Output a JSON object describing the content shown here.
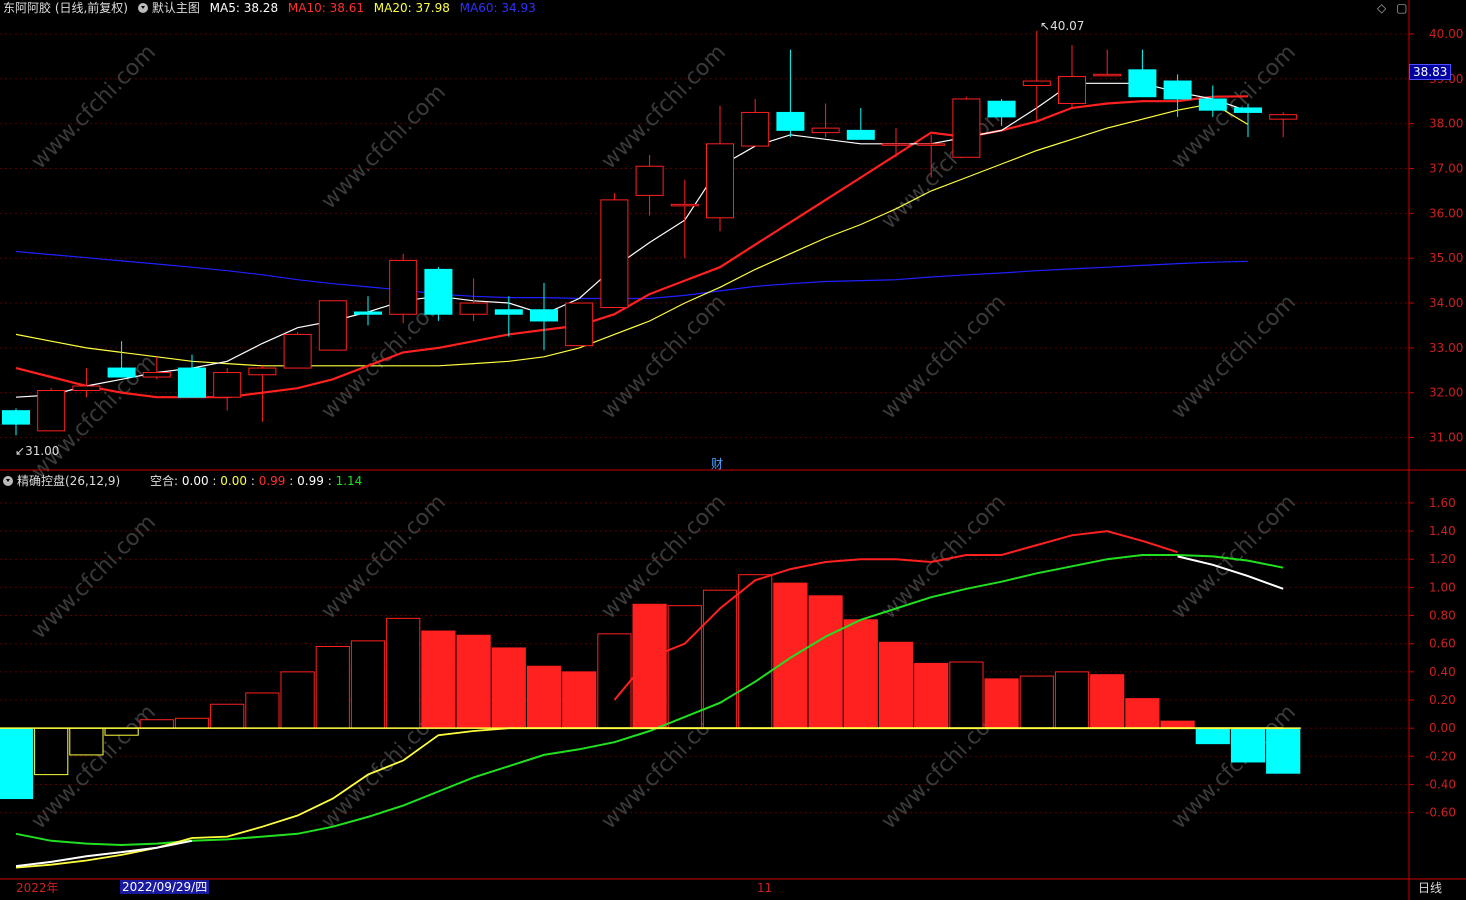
{
  "header": {
    "stock_name": "东阿阿胶 (日线,前复权)",
    "main_template": "默认主图",
    "ma5_label": "MA5: 38.28",
    "ma10_label": "MA10: 38.61",
    "ma20_label": "MA20: 37.98",
    "ma60_label": "MA60: 34.93",
    "top_icons": [
      "◇",
      "▢"
    ]
  },
  "sub_header": {
    "indicator_name": "精确控盘(26,12,9)",
    "kongge_label": "空合:",
    "v1": "0.00",
    "sep1": ":",
    "v2": "0.00",
    "sep2": ":",
    "v3": "0.99",
    "sep3": ":",
    "v4": "0.99",
    "sep4": ":",
    "v5": "1.14"
  },
  "bottom_bar": {
    "year_label": "2022年",
    "date_label": "2022/09/29/四",
    "month_marker": "11",
    "period_button": "日线"
  },
  "misc": {
    "cai_marker": "财",
    "watermark": "www.cfchi.com",
    "price_tag": "38.83",
    "high_annot": "40.07",
    "low_annot": "31.00"
  },
  "colors": {
    "up": "#ff2020",
    "down": "#00ffff",
    "ma5": "#ffffff",
    "ma10": "#ff2020",
    "ma20": "#ffff40",
    "ma60": "#2020ff",
    "grid": "#5a0000",
    "axis": "#cc0000",
    "green_line": "#20e020",
    "white_line": "#ffffff",
    "yellow_line": "#ffff40"
  },
  "chart_data": [
    {
      "type": "candlestick",
      "title": "东阿阿胶 (日线,前复权)",
      "y_ticks": [
        "31.00",
        "32.00",
        "33.00",
        "34.00",
        "35.00",
        "36.00",
        "37.00",
        "38.00",
        "39.00",
        "40.00"
      ],
      "ylim": [
        30.5,
        40.4
      ],
      "ohlc": [
        [
          31.6,
          31.65,
          31.05,
          31.3
        ],
        [
          31.15,
          32.1,
          31.15,
          32.05
        ],
        [
          32.05,
          32.55,
          31.9,
          32.15
        ],
        [
          32.55,
          33.15,
          32.4,
          32.35
        ],
        [
          32.35,
          32.8,
          32.3,
          32.45
        ],
        [
          32.55,
          32.85,
          31.9,
          31.9
        ],
        [
          31.9,
          32.55,
          31.6,
          32.45
        ],
        [
          32.4,
          32.6,
          31.35,
          32.55
        ],
        [
          32.55,
          33.35,
          32.55,
          33.3
        ],
        [
          32.95,
          33.95,
          32.95,
          34.05
        ],
        [
          33.8,
          34.15,
          33.5,
          33.75
        ],
        [
          33.75,
          35.1,
          33.55,
          34.95
        ],
        [
          34.75,
          34.8,
          33.6,
          33.75
        ],
        [
          33.75,
          34.55,
          33.6,
          34.0
        ],
        [
          33.85,
          34.15,
          33.25,
          33.75
        ],
        [
          33.85,
          34.45,
          32.95,
          33.6
        ],
        [
          33.05,
          34.0,
          33.05,
          34.0
        ],
        [
          33.9,
          36.45,
          33.9,
          36.3
        ],
        [
          36.4,
          37.3,
          35.95,
          37.05
        ],
        [
          36.2,
          36.75,
          35.0,
          36.2
        ],
        [
          35.9,
          38.4,
          35.6,
          37.55
        ],
        [
          37.5,
          38.55,
          37.5,
          38.25
        ],
        [
          38.25,
          39.65,
          37.7,
          37.85
        ],
        [
          37.8,
          38.45,
          37.7,
          37.9
        ],
        [
          37.85,
          38.35,
          37.65,
          37.65
        ],
        [
          37.55,
          37.9,
          37.25,
          37.55
        ],
        [
          37.55,
          37.75,
          36.8,
          37.55
        ],
        [
          37.25,
          38.6,
          37.25,
          38.55
        ],
        [
          38.5,
          38.55,
          37.95,
          38.15
        ],
        [
          38.85,
          40.07,
          38.05,
          38.95
        ],
        [
          38.45,
          39.75,
          38.35,
          39.05
        ],
        [
          39.1,
          39.65,
          39.1,
          39.1
        ],
        [
          39.2,
          39.65,
          38.6,
          38.6
        ],
        [
          38.95,
          39.1,
          38.15,
          38.55
        ],
        [
          38.55,
          38.85,
          38.15,
          38.3
        ],
        [
          38.35,
          38.45,
          37.7,
          38.25
        ],
        [
          38.1,
          38.25,
          37.7,
          38.2
        ]
      ],
      "ma5": [
        31.9,
        31.95,
        32.15,
        32.3,
        32.45,
        32.55,
        32.7,
        33.1,
        33.45,
        33.6,
        33.8,
        34.05,
        34.15,
        34.05,
        34.0,
        33.75,
        34.1,
        34.8,
        35.35,
        35.85,
        37.05,
        37.5,
        37.75,
        37.65,
        37.55,
        37.55,
        37.55,
        37.7,
        37.85,
        38.35,
        38.9,
        38.9,
        38.9,
        38.7,
        38.55,
        38.28
      ],
      "ma10": [
        32.55,
        32.35,
        32.15,
        32.0,
        31.9,
        31.9,
        31.9,
        32.0,
        32.1,
        32.3,
        32.6,
        32.9,
        33.0,
        33.15,
        33.3,
        33.4,
        33.5,
        33.75,
        34.2,
        34.5,
        34.8,
        35.3,
        35.8,
        36.3,
        36.8,
        37.3,
        37.8,
        37.7,
        37.85,
        38.05,
        38.35,
        38.45,
        38.5,
        38.5,
        38.6,
        38.61
      ],
      "ma20": [
        33.3,
        33.15,
        33.0,
        32.9,
        32.8,
        32.7,
        32.65,
        32.6,
        32.6,
        32.6,
        32.6,
        32.6,
        32.6,
        32.65,
        32.7,
        32.8,
        33.0,
        33.3,
        33.6,
        34.0,
        34.35,
        34.75,
        35.1,
        35.45,
        35.75,
        36.1,
        36.5,
        36.8,
        37.1,
        37.4,
        37.65,
        37.9,
        38.1,
        38.3,
        38.45,
        37.98
      ],
      "ma60": [
        35.15,
        35.08,
        35.01,
        34.94,
        34.87,
        34.8,
        34.72,
        34.63,
        34.52,
        34.43,
        34.36,
        34.29,
        34.2,
        34.15,
        34.12,
        34.12,
        34.1,
        34.1,
        34.1,
        34.17,
        34.27,
        34.37,
        34.43,
        34.48,
        34.5,
        34.52,
        34.58,
        34.63,
        34.67,
        34.72,
        34.76,
        34.8,
        34.84,
        34.88,
        34.91,
        34.93
      ]
    },
    {
      "type": "bar",
      "title": "精确控盘(26,12,9)",
      "y_ticks": [
        "-0.60",
        "-0.40",
        "-0.20",
        "0.00",
        "0.20",
        "0.40",
        "0.60",
        "0.80",
        "1.00",
        "1.20",
        "1.40",
        "1.60"
      ],
      "ylim": [
        -1.05,
        1.72
      ],
      "histogram": [
        -0.5,
        -0.33,
        -0.19,
        -0.05,
        0.06,
        0.07,
        0.17,
        0.25,
        0.4,
        0.58,
        0.62,
        0.78,
        0.69,
        0.66,
        0.57,
        0.44,
        0.4,
        0.67,
        0.88,
        0.87,
        0.98,
        1.09,
        1.03,
        0.94,
        0.77,
        0.61,
        0.46,
        0.47,
        0.35,
        0.37,
        0.4,
        0.38,
        0.21,
        0.05,
        -0.11,
        -0.24,
        -0.32
      ],
      "hist_fill": [
        1,
        0,
        0,
        0,
        0,
        0,
        0,
        0,
        0,
        0,
        0,
        0,
        1,
        1,
        1,
        1,
        1,
        0,
        1,
        0,
        0,
        0,
        1,
        1,
        1,
        1,
        1,
        0,
        1,
        0,
        0,
        1,
        1,
        1,
        1,
        1,
        1
      ],
      "red_line": [
        null,
        null,
        null,
        null,
        null,
        null,
        null,
        null,
        null,
        null,
        null,
        null,
        null,
        null,
        null,
        null,
        null,
        0.2,
        0.5,
        0.6,
        0.85,
        1.05,
        1.13,
        1.18,
        1.2,
        1.2,
        1.18,
        1.23,
        1.23,
        1.3,
        1.37,
        1.4,
        1.33,
        1.25,
        null,
        null,
        null
      ],
      "white_line": [
        -0.98,
        -0.95,
        -0.91,
        -0.88,
        -0.85,
        -0.8,
        null,
        null,
        null,
        null,
        null,
        null,
        null,
        null,
        null,
        null,
        null,
        null,
        null,
        null,
        null,
        null,
        null,
        null,
        null,
        null,
        null,
        null,
        null,
        null,
        null,
        null,
        null,
        1.22,
        1.16,
        1.08,
        0.99
      ],
      "yellow_line": [
        -0.99,
        -0.97,
        -0.94,
        -0.9,
        -0.85,
        -0.78,
        -0.77,
        -0.7,
        -0.62,
        -0.5,
        -0.33,
        -0.23,
        -0.05,
        -0.02,
        0,
        0,
        0,
        0,
        0,
        0,
        0,
        0,
        0,
        0,
        0,
        0,
        0,
        0,
        0,
        0,
        0,
        0,
        0,
        0,
        0,
        0,
        0
      ],
      "green_line": [
        -0.75,
        -0.8,
        -0.82,
        -0.83,
        -0.82,
        -0.8,
        -0.79,
        -0.77,
        -0.75,
        -0.7,
        -0.63,
        -0.55,
        -0.45,
        -0.35,
        -0.27,
        -0.19,
        -0.15,
        -0.1,
        -0.02,
        0.08,
        0.18,
        0.33,
        0.5,
        0.65,
        0.77,
        0.85,
        0.93,
        0.99,
        1.04,
        1.1,
        1.15,
        1.2,
        1.23,
        1.23,
        1.22,
        1.19,
        1.14
      ]
    }
  ]
}
